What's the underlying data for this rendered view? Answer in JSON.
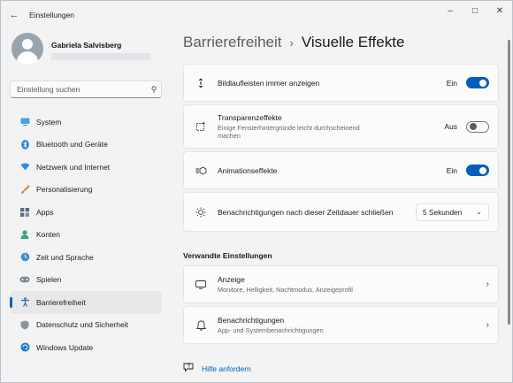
{
  "window": {
    "title": "Einstellungen"
  },
  "profile": {
    "name": "Gabriela Salvisberg"
  },
  "search": {
    "placeholder": "Einstellung suchen"
  },
  "nav": [
    {
      "label": "System",
      "icon": "monitor-icon"
    },
    {
      "label": "Bluetooth und Geräte",
      "icon": "bluetooth-icon"
    },
    {
      "label": "Netzwerk und Internet",
      "icon": "wifi-icon"
    },
    {
      "label": "Personalisierung",
      "icon": "brush-icon"
    },
    {
      "label": "Apps",
      "icon": "apps-icon"
    },
    {
      "label": "Konten",
      "icon": "person-icon"
    },
    {
      "label": "Zeit und Sprache",
      "icon": "globe-clock-icon"
    },
    {
      "label": "Spielen",
      "icon": "gamepad-icon"
    },
    {
      "label": "Barrierefreiheit",
      "icon": "accessibility-icon",
      "active": true
    },
    {
      "label": "Datenschutz und Sicherheit",
      "icon": "shield-icon"
    },
    {
      "label": "Windows Update",
      "icon": "update-icon"
    }
  ],
  "breadcrumb": {
    "parent": "Barrierefreiheit",
    "separator": "›",
    "current": "Visuelle Effekte"
  },
  "settings": [
    {
      "title": "Bildlaufleisten immer anzeigen",
      "icon": "scrollbar-icon",
      "state_label": "Ein",
      "on": true
    },
    {
      "title": "Transparenzeffekte",
      "description": "Einige Fensterhintergründe leicht durchscheinend machen",
      "icon": "transparency-icon",
      "state_label": "Aus",
      "on": false
    },
    {
      "title": "Animationseffekte",
      "icon": "animation-icon",
      "state_label": "Ein",
      "on": true
    },
    {
      "title": "Benachrichtigungen nach dieser Zeitdauer schließen",
      "icon": "brightness-icon",
      "dropdown_value": "5 Sekunden"
    }
  ],
  "related": {
    "heading": "Verwandte Einstellungen",
    "items": [
      {
        "title": "Anzeige",
        "description": "Monitore, Helligkeit, Nachtmodus, Anzeigeprofil",
        "icon": "display-icon"
      },
      {
        "title": "Benachrichtigungen",
        "description": "App- und Systembenachrichtigungen",
        "icon": "bell-icon"
      }
    ]
  },
  "help": {
    "label": "Hilfe anfordern"
  },
  "colors": {
    "accent": "#005fb8",
    "window_bg": "#f3f3f3",
    "card_bg": "#fbfbfb"
  }
}
